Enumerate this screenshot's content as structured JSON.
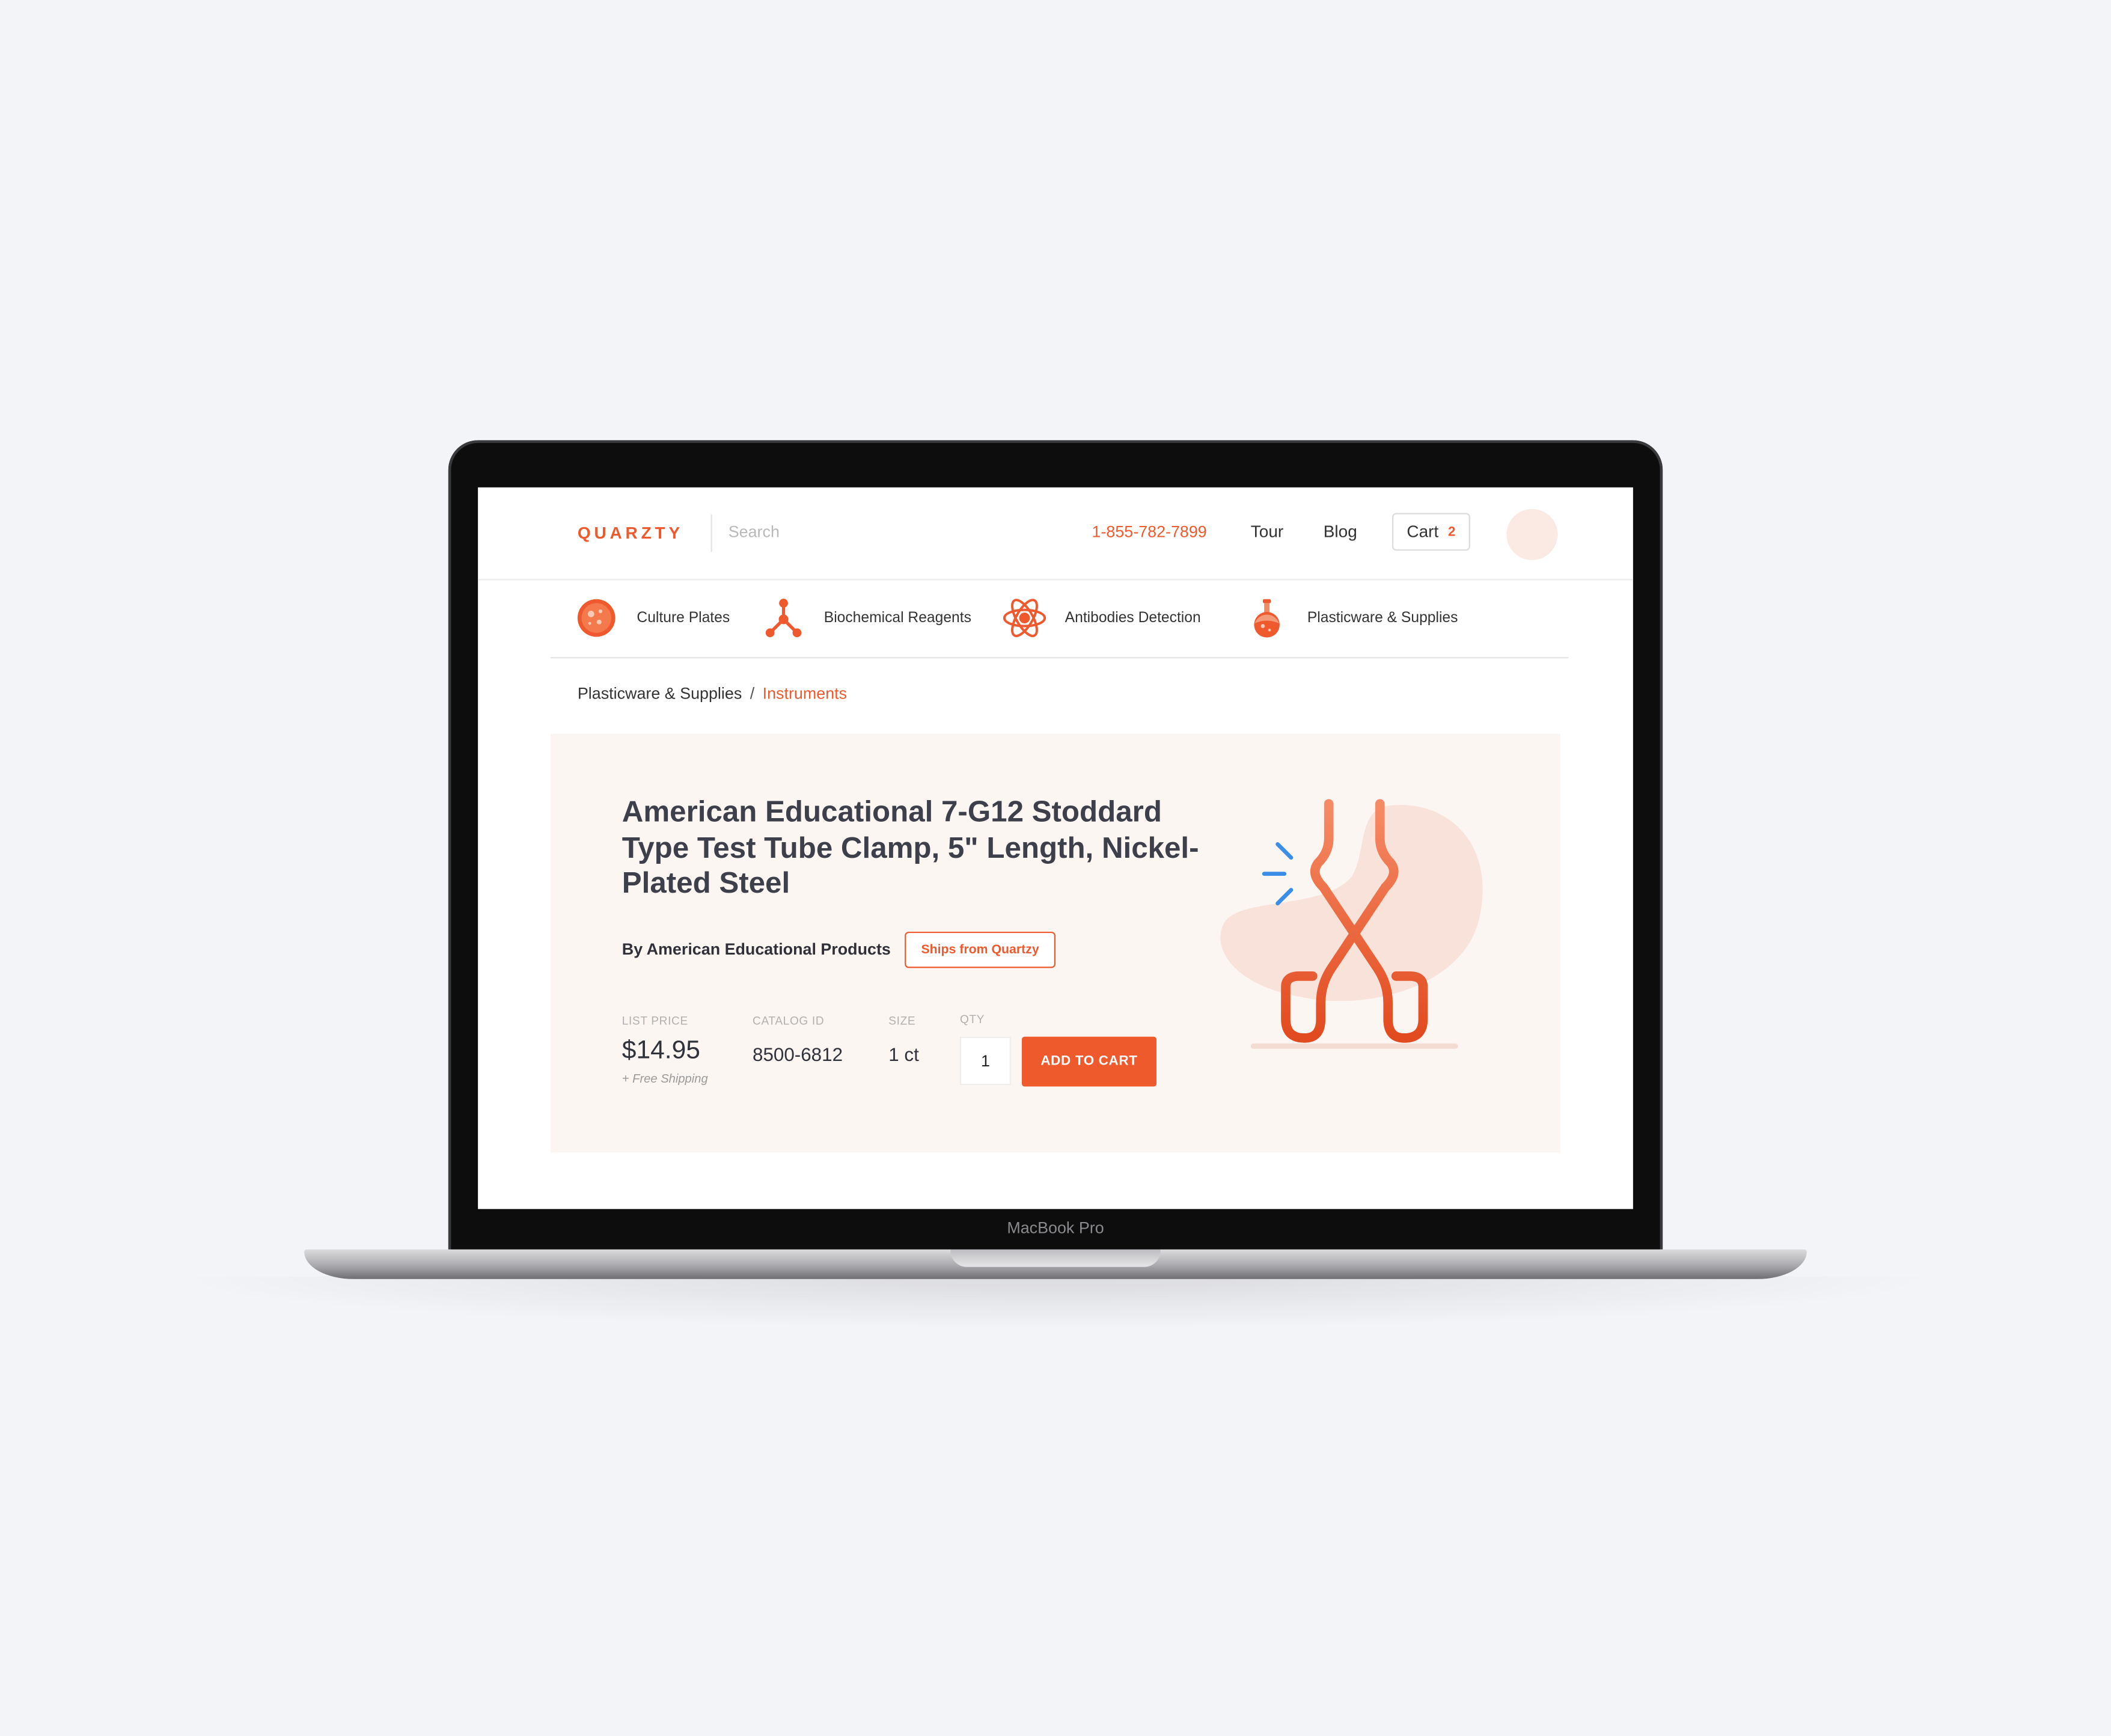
{
  "device": {
    "label": "MacBook Pro"
  },
  "header": {
    "logo": "QUARZTY",
    "search_placeholder": "Search",
    "phone": "1-855-782-7899",
    "nav": {
      "tour": "Tour",
      "blog": "Blog"
    },
    "cart": {
      "label": "Cart",
      "count": "2"
    }
  },
  "categories": [
    {
      "label": "Culture Plates",
      "icon": "culture-plate-icon"
    },
    {
      "label": "Biochemical Reagents",
      "icon": "molecule-icon"
    },
    {
      "label": "Antibodies Detection",
      "icon": "atom-icon"
    },
    {
      "label": "Plasticware & Supplies",
      "icon": "flask-icon"
    }
  ],
  "breadcrumb": {
    "parent": "Plasticware & Supplies",
    "separator": "/",
    "current": "Instruments"
  },
  "product": {
    "title": "American Educational 7-G12 Stoddard Type Test Tube Clamp, 5\" Length, Nickel-Plated Steel",
    "brand": "By American Educational Products",
    "badge": "Ships from Quartzy",
    "fields": {
      "list_price_label": "List Price",
      "list_price": "$14.95",
      "shipping_note": "+ Free Shipping",
      "catalog_label": "Catalog ID",
      "catalog_id": "8500-6812",
      "size_label": "Size",
      "size": "1 ct",
      "qty_label": "Qty",
      "qty": "1"
    },
    "add_to_cart": "ADD TO CART",
    "illustration_icon": "test-tube-clamp-icon"
  },
  "colors": {
    "accent": "#ee5a2e",
    "hero_bg": "#fcf6f3",
    "text_dark": "#3d3f4a",
    "blue_accent": "#3a8ee8"
  }
}
